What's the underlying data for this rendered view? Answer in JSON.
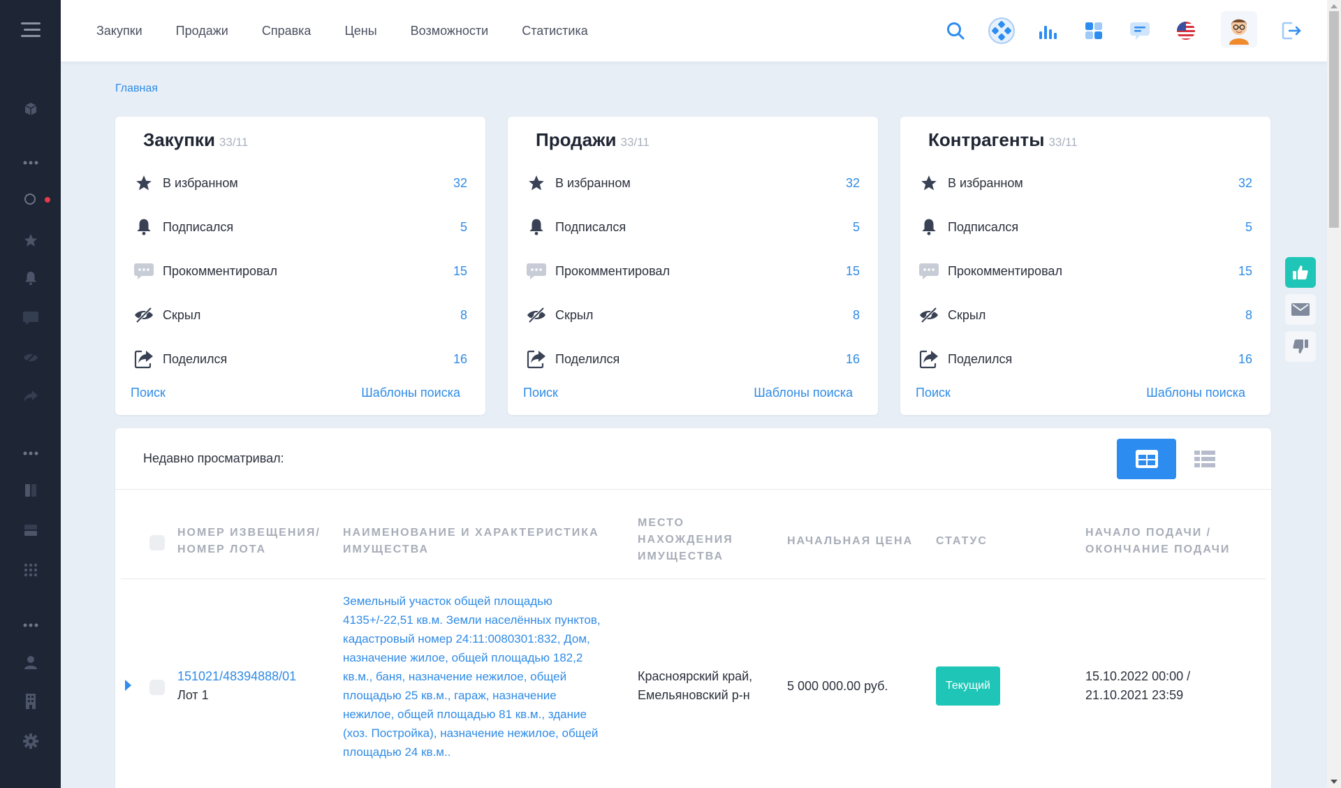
{
  "nav": {
    "items": [
      "Закупки",
      "Продажи",
      "Справка",
      "Цены",
      "Возможности",
      "Статистика"
    ]
  },
  "breadcrumb": "Главная",
  "cards": [
    {
      "title": "Закупки",
      "subtitle": "33/11",
      "rows": [
        {
          "label": "В избранном",
          "count": "32",
          "icon": "star-icon"
        },
        {
          "label": "Подписался",
          "count": "5",
          "icon": "bell-icon"
        },
        {
          "label": "Прокомментировал",
          "count": "15",
          "icon": "comment-icon"
        },
        {
          "label": "Скрыл",
          "count": "8",
          "icon": "eye-off-icon"
        },
        {
          "label": "Поделился",
          "count": "16",
          "icon": "share-icon"
        }
      ],
      "link_left": "Поиск",
      "link_right": "Шаблоны поиска"
    },
    {
      "title": "Продажи",
      "subtitle": "33/11",
      "rows": [
        {
          "label": "В избранном",
          "count": "32",
          "icon": "star-icon"
        },
        {
          "label": "Подписался",
          "count": "5",
          "icon": "bell-icon"
        },
        {
          "label": "Прокомментировал",
          "count": "15",
          "icon": "comment-icon"
        },
        {
          "label": "Скрыл",
          "count": "8",
          "icon": "eye-off-icon"
        },
        {
          "label": "Поделился",
          "count": "16",
          "icon": "share-icon"
        }
      ],
      "link_left": "Поиск",
      "link_right": "Шаблоны поиска"
    },
    {
      "title": "Контрагенты",
      "subtitle": "33/11",
      "rows": [
        {
          "label": "В избранном",
          "count": "32",
          "icon": "star-icon"
        },
        {
          "label": "Подписался",
          "count": "5",
          "icon": "bell-icon"
        },
        {
          "label": "Прокомментировал",
          "count": "15",
          "icon": "comment-icon"
        },
        {
          "label": "Скрыл",
          "count": "8",
          "icon": "eye-off-icon"
        },
        {
          "label": "Поделился",
          "count": "16",
          "icon": "share-icon"
        }
      ],
      "link_left": "Поиск",
      "link_right": "Шаблоны поиска"
    }
  ],
  "recent": {
    "title": "Недавно просматривал:",
    "view_modes": [
      "grid-view-icon",
      "list-view-icon"
    ],
    "columns": [
      "Номер извещения/ номер лота",
      "Наименование и характеристика имущества",
      "Место нахождения имущества",
      "Начальная цена",
      "Статус",
      "Начало подачи / окончание подачи"
    ],
    "rows": [
      {
        "notice_number": "151021/48394888/01",
        "lot": "Лот 1",
        "description": "Земельный участок общей площадью 4135+/-22,51 кв.м. Земли населённых пунктов, кадастровый номер 24:11:0080301:832, Дом, назначение жилое, общей площадью 182,2 кв.м., баня, назначение нежилое, общей площадью 25 кв.м., гараж, назначение нежилое, общей площадью 81 кв.м., здание (хоз. Постройка), назначение нежилое, общей площадью 24 кв.м..",
        "location": "Красноярский край, Емельяновский р-н",
        "price": "5 000 000.00 руб.",
        "status": "Текущий",
        "dates": "15.10.2022 00:00 / 21.10.2021 23:59"
      }
    ]
  },
  "colors": {
    "sidebar": "#1e2535",
    "accent": "#2d8cf0",
    "link": "#2f8be6",
    "status": "#1fc6b7",
    "like": "#1fc6b7"
  },
  "top_icons": [
    "search-icon",
    "joystick-icon",
    "bar-chart-icon",
    "dashboard-icon",
    "chat-icon",
    "us-flag-icon",
    "user-avatar",
    "logout-icon"
  ],
  "floating_actions": [
    "thumbs-up-icon",
    "mail-icon",
    "thumbs-down-icon"
  ]
}
